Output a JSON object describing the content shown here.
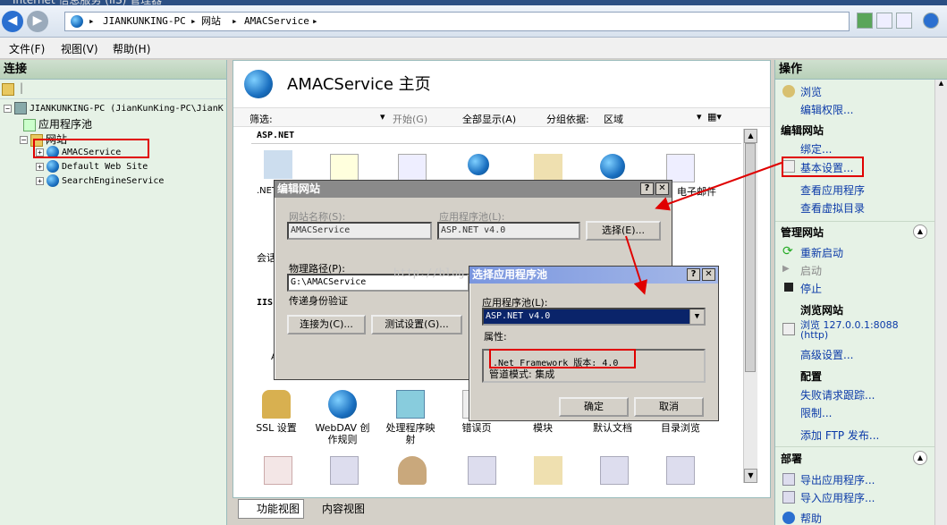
{
  "window": {
    "title": "Internet 信息服务 (IIS) 管理器"
  },
  "address": {
    "crumbs": [
      "JIANKUNKING-PC",
      "网站",
      "AMACService"
    ]
  },
  "menu": {
    "items": [
      "文件(F)",
      "视图(V)",
      "帮助(H)"
    ]
  },
  "connections": {
    "title": "连接",
    "tree": {
      "server": "JIANKUNKING-PC (JianKunKing-PC\\JianK",
      "app_pools": "应用程序池",
      "sites": "网站",
      "site_items": [
        "AMACService",
        "Default Web Site",
        "SearchEngineService"
      ]
    }
  },
  "main": {
    "title": "AMACService 主页",
    "filter_label": "筛选:",
    "start_label": "开始(G)",
    "show_all_label": "全部显示(A)",
    "group_label": "分组依据:",
    "group_value": "区域",
    "section_aspnet": "ASP.NET",
    "section_iis": "IIS",
    "partial_labels": {
      "net": ".NET",
      "session": "会话",
      "email": "电子邮件",
      "a": "A"
    },
    "features_row3": [
      {
        "label": "SSL 设置",
        "icon": "lock-icon"
      },
      {
        "label": "WebDAV 创作规则",
        "icon": "webdav-icon"
      },
      {
        "label": "处理程序映射",
        "icon": "handler-mapping-icon"
      },
      {
        "label": "错误页",
        "icon": "error-pages-icon"
      },
      {
        "label": "模块",
        "icon": "modules-icon"
      },
      {
        "label": "默认文档",
        "icon": "default-document-icon"
      },
      {
        "label": "目录浏览",
        "icon": "directory-browsing-icon"
      }
    ]
  },
  "edit_site_dialog": {
    "title": "编辑网站",
    "site_name_label": "网站名称(S):",
    "site_name_value": "AMACService",
    "app_pool_label": "应用程序池(L):",
    "app_pool_value": "ASP.NET v4.0",
    "select_button": "选择(E)...",
    "physical_path_label": "物理路径(P):",
    "physical_path_value": "G:\\AMACService",
    "pass_through_label": "传递身份验证",
    "connect_as_button": "连接为(C)...",
    "test_settings_button": "测试设置(G)..."
  },
  "select_pool_dialog": {
    "title": "选择应用程序池",
    "pool_label": "应用程序池(L):",
    "pool_value": "ASP.NET v4.0",
    "properties_label": "属性:",
    "framework_line": ".Net Framework 版本: 4.0",
    "pipeline_line": "管道模式: 集成",
    "ok_button": "确定",
    "cancel_button": "取消"
  },
  "watermark": "http://blog.csdn.net/",
  "actions": {
    "title": "操作",
    "top": [
      "浏览",
      "编辑权限..."
    ],
    "edit_site_header": "编辑网站",
    "edit_site": [
      "绑定...",
      "基本设置...",
      "查看应用程序",
      "查看虚拟目录"
    ],
    "manage_header": "管理网站",
    "manage": [
      "重新启动",
      "启动",
      "停止"
    ],
    "browse_header": "浏览网站",
    "browse_link": "浏览 127.0.0.1:8088",
    "browse_sub": "(http)",
    "advanced": "高级设置...",
    "config_header": "配置",
    "config": [
      "失败请求跟踪...",
      "限制...",
      "添加 FTP 发布..."
    ],
    "deploy_header": "部署",
    "deploy": [
      "导出应用程序...",
      "导入应用程序..."
    ],
    "help": "帮助"
  },
  "bottom_tabs": [
    "功能视图",
    "内容视图"
  ],
  "colors": {
    "annotation_red": "#e00000",
    "link_blue": "#0b3aa8",
    "panel_green": "#d9ecd9"
  }
}
